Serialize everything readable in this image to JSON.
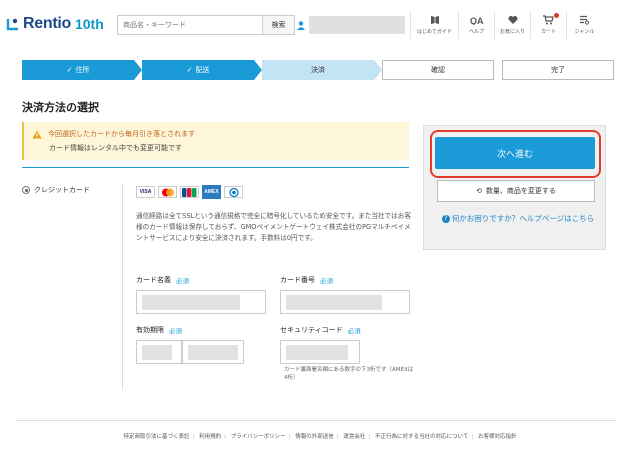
{
  "header": {
    "logo_name": "Rentio",
    "logo_suffix": "10th",
    "search_placeholder": "商品名・キーワード",
    "search_button": "検索",
    "nav": [
      {
        "icon": "guide-icon",
        "label": "はじめてガイド"
      },
      {
        "icon": "qa-icon",
        "label": "ヘルプ"
      },
      {
        "icon": "heart-icon",
        "label": "お気に入り"
      },
      {
        "icon": "cart-icon",
        "label": "カート"
      },
      {
        "icon": "menu-list-icon",
        "label": "ジャンル"
      }
    ]
  },
  "steps": [
    {
      "label": "住所",
      "state": "done"
    },
    {
      "label": "配送",
      "state": "done"
    },
    {
      "label": "決済",
      "state": "current"
    },
    {
      "label": "確認",
      "state": "todo"
    },
    {
      "label": "完了",
      "state": "todo"
    }
  ],
  "page_title": "決済方法の選択",
  "notice": {
    "line1": "今回選択したカードから毎月引き落とされます",
    "line2": "カード情報はレンタル中でも変更可能です"
  },
  "payment": {
    "method_label": "クレジットカード",
    "cards": [
      "VISA",
      "MC",
      "JCB",
      "AMEX",
      "DC"
    ],
    "description": "通信経路は全てSSLという通信規格で完全に暗号化しているため安全です。また当社ではお客様のカード情報は保存しておらず、GMOペイメントゲートウェイ株式会社のPGマルチペイメントサービスにより安全に決済されます。手数料は0円です。",
    "required": "必須",
    "card_name_label": "カード名義",
    "card_number_label": "カード番号",
    "expiry_label": "有効期限",
    "security_code_label": "セキュリティコード",
    "security_note": "カード裏面署名欄にある数字の下3桁です（AMEXは4桁）"
  },
  "side": {
    "next_button": "次へ進む",
    "change_button": "数量、商品を変更する",
    "help_text": "何かお困りですか？ヘルプページはこちら"
  },
  "footer": {
    "links": [
      "特定商取引法に基づく表記",
      "利用規約",
      "プライバシーポリシー",
      "情報の外部送信",
      "運営会社",
      "不正行為に対する当社の対応について",
      "お客様対応指針"
    ]
  },
  "colors": {
    "accent": "#1a9ad6",
    "highlight": "#e53a2c",
    "brand": "#1c4a8a"
  }
}
